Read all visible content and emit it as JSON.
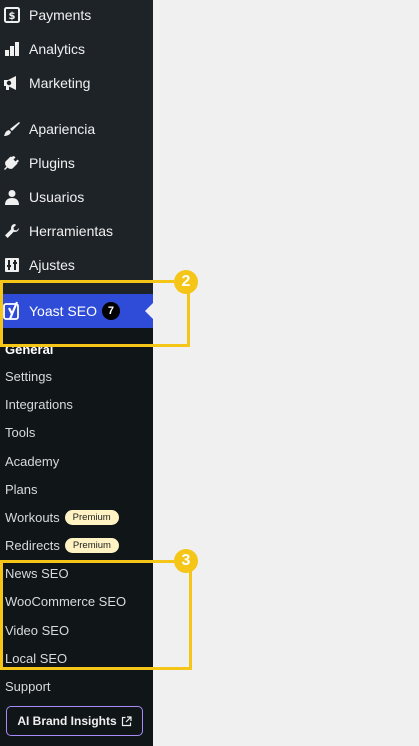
{
  "menu": [
    {
      "key": "payments",
      "label": "Payments",
      "icon": "payments-icon"
    },
    {
      "key": "analytics",
      "label": "Analytics",
      "icon": "analytics-icon"
    },
    {
      "key": "marketing",
      "label": "Marketing",
      "icon": "megaphone-icon"
    },
    {
      "key": "apariencia",
      "label": "Apariencia",
      "icon": "paintbrush-icon"
    },
    {
      "key": "plugins",
      "label": "Plugins",
      "icon": "plugin-icon"
    },
    {
      "key": "usuarios",
      "label": "Usuarios",
      "icon": "user-icon"
    },
    {
      "key": "herramientas",
      "label": "Herramientas",
      "icon": "wrench-icon"
    },
    {
      "key": "ajustes",
      "label": "Ajustes",
      "icon": "settings-icon"
    }
  ],
  "yoast": {
    "label": "Yoast SEO",
    "badge": "7",
    "icon": "yoast-logo-icon"
  },
  "submenu": [
    {
      "label": "General",
      "current": true
    },
    {
      "label": "Settings"
    },
    {
      "label": "Integrations"
    },
    {
      "label": "Tools"
    },
    {
      "label": "Academy"
    },
    {
      "label": "Plans"
    },
    {
      "label": "Workouts",
      "badge": "Premium"
    },
    {
      "label": "Redirects",
      "badge": "Premium"
    },
    {
      "label": "News SEO"
    },
    {
      "label": "WooCommerce SEO"
    },
    {
      "label": "Video SEO"
    },
    {
      "label": "Local SEO"
    },
    {
      "label": "Support"
    }
  ],
  "ai_button": {
    "label": "AI Brand Insights",
    "icon": "external-link-icon"
  },
  "highlights": [
    {
      "number": "2"
    },
    {
      "number": "3"
    }
  ],
  "colors": {
    "sidebar": "#1d2327",
    "submenu": "#101517",
    "yoast_active": "#2f4cd8",
    "highlight": "#f5c518",
    "premium_badge": "#fff3c4",
    "ai_border": "#a78bfa"
  }
}
